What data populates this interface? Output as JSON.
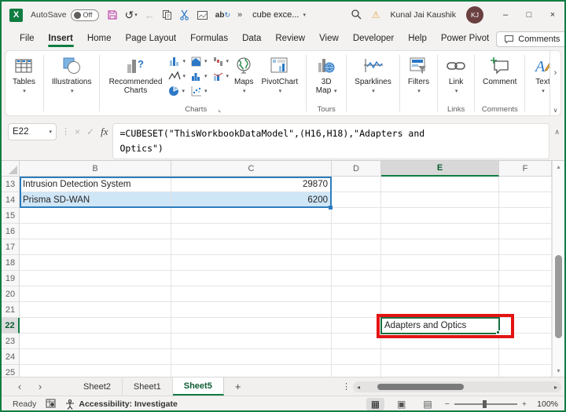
{
  "titlebar": {
    "autosave_label": "AutoSave",
    "autosave_state": "Off",
    "doc_title": "cube exce...",
    "user_name": "Kunal Jai Kaushik",
    "user_initials": "KJ"
  },
  "ribbon_tabs": [
    {
      "label": "File",
      "active": false
    },
    {
      "label": "Insert",
      "active": true
    },
    {
      "label": "Home",
      "active": false
    },
    {
      "label": "Page Layout",
      "active": false
    },
    {
      "label": "Formulas",
      "active": false
    },
    {
      "label": "Data",
      "active": false
    },
    {
      "label": "Review",
      "active": false
    },
    {
      "label": "View",
      "active": false
    },
    {
      "label": "Developer",
      "active": false
    },
    {
      "label": "Help",
      "active": false
    },
    {
      "label": "Power Pivot",
      "active": false
    }
  ],
  "tab_actions": {
    "comments_label": "Comments"
  },
  "ribbon": {
    "buttons": {
      "tables": "Tables",
      "illustrations": "Illustrations",
      "recommended_charts": "Recommended Charts",
      "maps": "Maps",
      "pivotchart": "PivotChart",
      "map_3d": "3D Map",
      "sparklines": "Sparklines",
      "filters": "Filters",
      "link": "Link",
      "comment": "Comment",
      "text": "Text"
    },
    "group_labels": {
      "charts": "Charts",
      "tours": "Tours",
      "links": "Links",
      "comments": "Comments"
    }
  },
  "formula_bar": {
    "name_box": "E22",
    "fx_label": "fx",
    "formula_line1": "=CUBESET(\"ThisWorkbookDataModel\",(H16,H18),\"Adapters and",
    "formula_line2": "Optics\")"
  },
  "grid": {
    "columns": [
      "B",
      "C",
      "D",
      "E",
      "F"
    ],
    "selected_column": "E",
    "row_start": 13,
    "row_end": 25,
    "selected_row": 22,
    "cells": [
      {
        "ref": "B13",
        "value": "Intrusion Detection System",
        "align": "left"
      },
      {
        "ref": "C13",
        "value": "29870",
        "align": "right"
      },
      {
        "ref": "B14",
        "value": "Prisma SD-WAN",
        "align": "left"
      },
      {
        "ref": "C14",
        "value": "6200",
        "align": "right"
      },
      {
        "ref": "E22",
        "value": "Adapters and Optics",
        "align": "left"
      }
    ],
    "highlighted_cells": [
      "B14",
      "C14"
    ],
    "active_cell": "E22"
  },
  "sheet_bar": {
    "tabs": [
      {
        "label": "Sheet2",
        "active": false
      },
      {
        "label": "Sheet1",
        "active": false
      },
      {
        "label": "Sheet5",
        "active": true
      }
    ],
    "add_label": "+"
  },
  "status_bar": {
    "ready": "Ready",
    "accessibility": "Accessibility: Investigate",
    "zoom_level": "100%"
  },
  "colors": {
    "accent_green": "#107c41",
    "selection_green": "#1a6e41",
    "highlight_blue": "#cfe6f7",
    "range_blue": "#2d7dbd",
    "annotation_red": "#e31313"
  }
}
